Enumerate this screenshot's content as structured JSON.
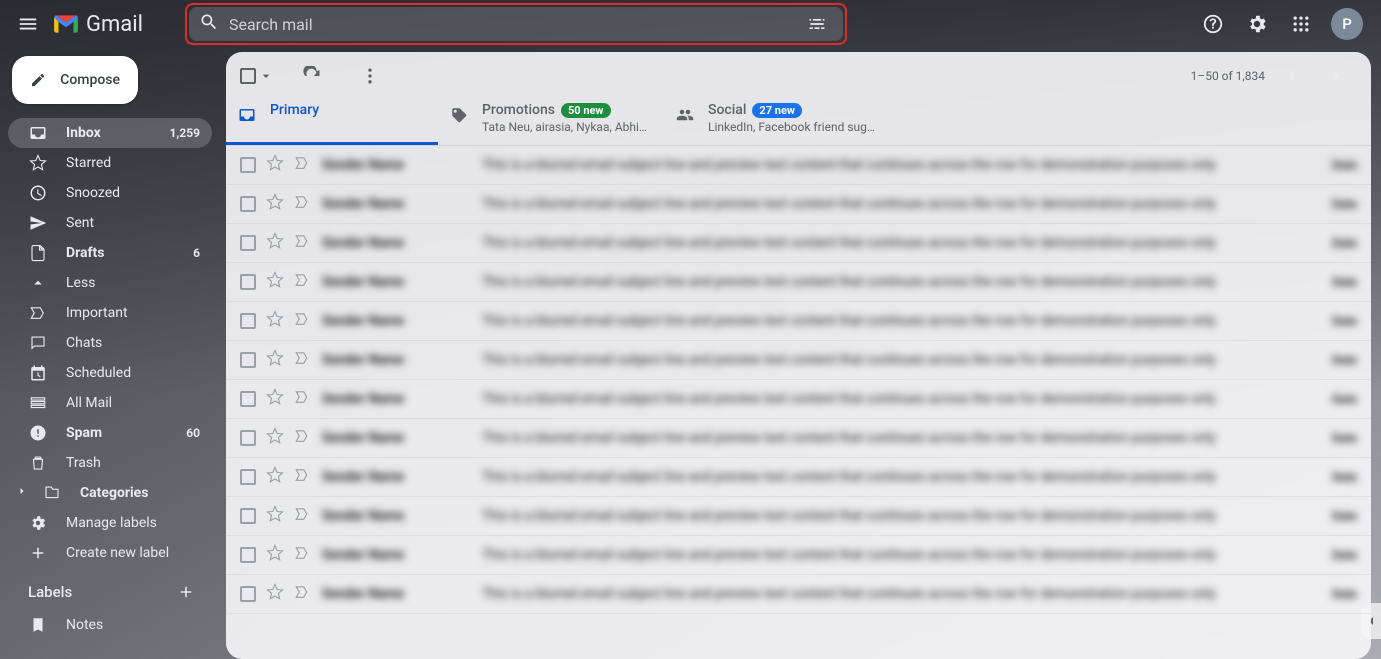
{
  "header": {
    "app_name": "Gmail",
    "search_placeholder": "Search mail",
    "avatar_letter": "P"
  },
  "sidebar": {
    "compose_label": "Compose",
    "items": [
      {
        "icon": "inbox",
        "label": "Inbox",
        "count": "1,259",
        "active": true,
        "bold": true
      },
      {
        "icon": "star",
        "label": "Starred",
        "count": "",
        "active": false,
        "bold": false
      },
      {
        "icon": "clock",
        "label": "Snoozed",
        "count": "",
        "active": false,
        "bold": false
      },
      {
        "icon": "send",
        "label": "Sent",
        "count": "",
        "active": false,
        "bold": false
      },
      {
        "icon": "draft",
        "label": "Drafts",
        "count": "6",
        "active": false,
        "bold": true
      },
      {
        "icon": "less",
        "label": "Less",
        "count": "",
        "active": false,
        "bold": false
      },
      {
        "icon": "important",
        "label": "Important",
        "count": "",
        "active": false,
        "bold": false
      },
      {
        "icon": "chats",
        "label": "Chats",
        "count": "",
        "active": false,
        "bold": false
      },
      {
        "icon": "scheduled",
        "label": "Scheduled",
        "count": "",
        "active": false,
        "bold": false
      },
      {
        "icon": "allmail",
        "label": "All Mail",
        "count": "",
        "active": false,
        "bold": false
      },
      {
        "icon": "spam",
        "label": "Spam",
        "count": "60",
        "active": false,
        "bold": true
      },
      {
        "icon": "trash",
        "label": "Trash",
        "count": "",
        "active": false,
        "bold": false
      },
      {
        "icon": "categories",
        "label": "Categories",
        "count": "",
        "active": false,
        "bold": true
      },
      {
        "icon": "manage",
        "label": "Manage labels",
        "count": "",
        "active": false,
        "bold": false
      },
      {
        "icon": "create",
        "label": "Create new label",
        "count": "",
        "active": false,
        "bold": false
      }
    ],
    "labels_header": "Labels",
    "labels": [
      {
        "label": "Notes"
      }
    ]
  },
  "toolbar": {
    "pagination": "1–50 of 1,834"
  },
  "tabs": [
    {
      "key": "primary",
      "label": "Primary",
      "sub": "",
      "badge": "",
      "badge_color": "",
      "active": true
    },
    {
      "key": "promotions",
      "label": "Promotions",
      "sub": "Tata Neu, airasia, Nykaa, AbhiBu...",
      "badge": "50 new",
      "badge_color": "green",
      "active": false
    },
    {
      "key": "social",
      "label": "Social",
      "sub": "LinkedIn, Facebook friend sugg...",
      "badge": "27 new",
      "badge_color": "blue",
      "active": false
    }
  ],
  "rows_count": 12
}
